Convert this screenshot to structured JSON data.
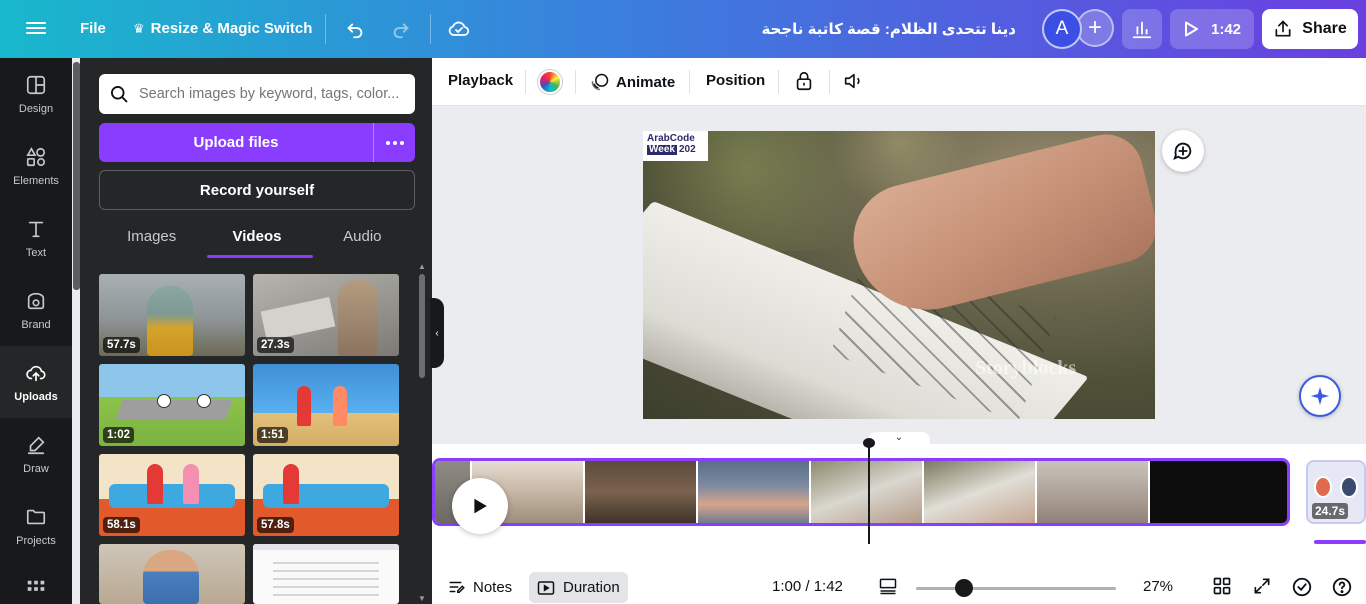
{
  "topbar": {
    "file_label": "File",
    "resize_label": "Resize & Magic Switch",
    "design_title": "دينا تتحدى الظلام: قصة كاتبة ناجحة",
    "avatar_initial": "A",
    "play_duration": "1:42",
    "share_label": "Share"
  },
  "rail": {
    "items": [
      {
        "label": "Design",
        "icon": "design-icon"
      },
      {
        "label": "Elements",
        "icon": "elements-icon"
      },
      {
        "label": "Text",
        "icon": "text-icon"
      },
      {
        "label": "Brand",
        "icon": "brand-icon"
      },
      {
        "label": "Uploads",
        "icon": "upload-cloud-icon"
      },
      {
        "label": "Draw",
        "icon": "draw-icon"
      },
      {
        "label": "Projects",
        "icon": "folder-icon"
      }
    ]
  },
  "panel": {
    "search_placeholder": "Search images by keyword, tags, color...",
    "upload_label": "Upload files",
    "record_label": "Record yourself",
    "tabs": [
      "Images",
      "Videos",
      "Audio"
    ],
    "active_tab": "Videos",
    "videos": [
      {
        "duration": "57.7s"
      },
      {
        "duration": "27.3s"
      },
      {
        "duration": "1:02"
      },
      {
        "duration": "1:51"
      },
      {
        "duration": "58.1s"
      },
      {
        "duration": "57.8s"
      }
    ]
  },
  "context_toolbar": {
    "playback_label": "Playback",
    "animate_label": "Animate",
    "position_label": "Position"
  },
  "canvas": {
    "logo_line1": "ArabCode",
    "logo_line2": "Week",
    "logo_year": "202",
    "watermark": "Storyblocks"
  },
  "timeline": {
    "next_clip_duration": "24.7s"
  },
  "bottombar": {
    "notes_label": "Notes",
    "duration_label": "Duration",
    "time_readout": "1:00 / 1:42",
    "zoom_level": "27%",
    "zoom_fraction": 0.24
  },
  "colors": {
    "accent": "#8b3dff",
    "rail_bg": "#18191b",
    "panel_bg": "#252627"
  }
}
